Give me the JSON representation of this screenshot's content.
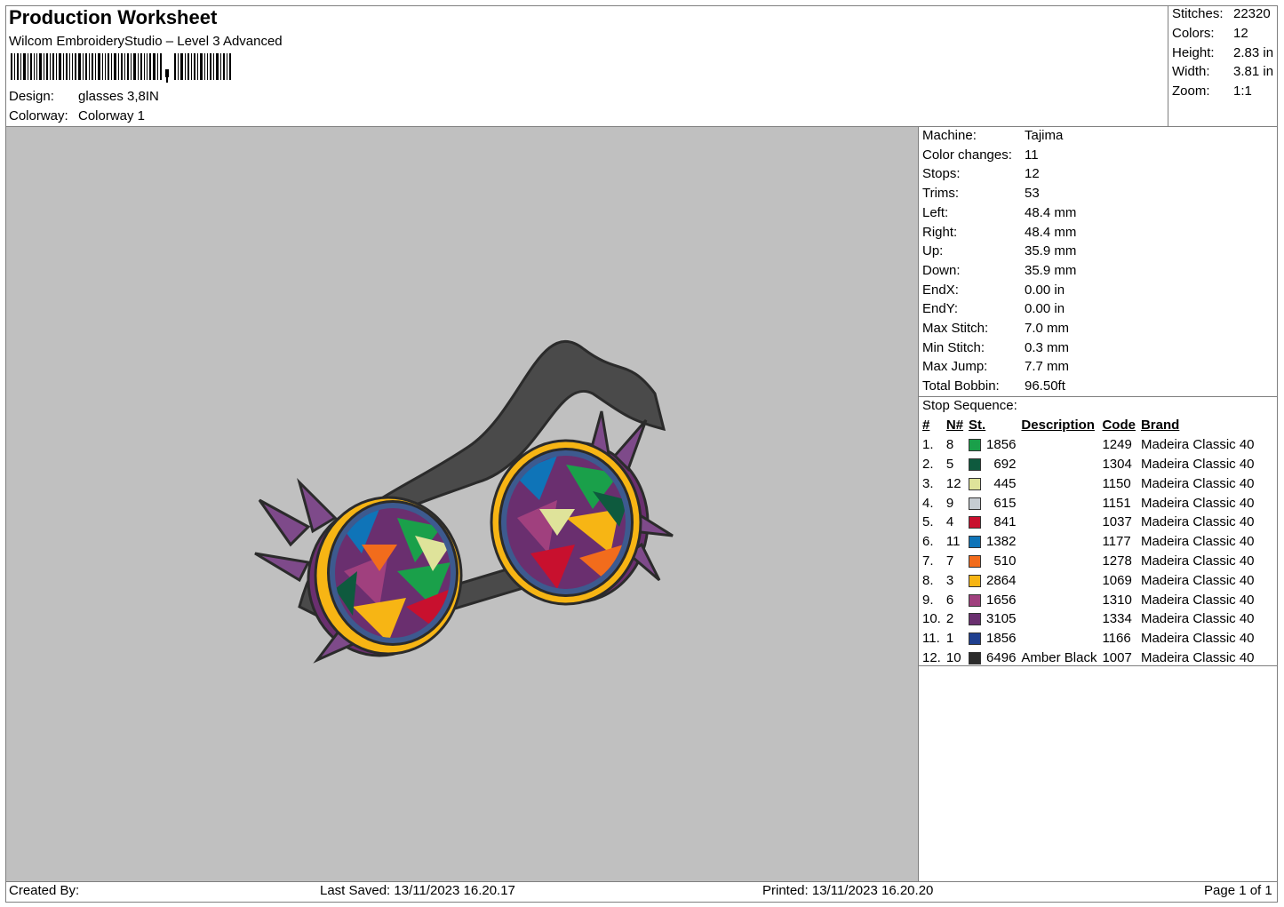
{
  "header": {
    "title": "Production Worksheet",
    "software": "Wilcom EmbroideryStudio – Level 3 Advanced",
    "design_label": "Design:",
    "design_value": "glasses 3,8IN",
    "colorway_label": "Colorway:",
    "colorway_value": "Colorway 1"
  },
  "summary": [
    {
      "label": "Stitches:",
      "value": "22320"
    },
    {
      "label": "Colors:",
      "value": "12"
    },
    {
      "label": "Height:",
      "value": "2.83 in"
    },
    {
      "label": "Width:",
      "value": "3.81 in"
    },
    {
      "label": "Zoom:",
      "value": "1:1"
    }
  ],
  "machine_info": [
    {
      "label": "Machine:",
      "value": "Tajima"
    },
    {
      "label": "Color changes:",
      "value": "11"
    },
    {
      "label": "Stops:",
      "value": "12"
    },
    {
      "label": "Trims:",
      "value": "53"
    },
    {
      "label": "Left:",
      "value": "48.4 mm"
    },
    {
      "label": "Right:",
      "value": "48.4 mm"
    },
    {
      "label": "Up:",
      "value": "35.9 mm"
    },
    {
      "label": "Down:",
      "value": "35.9 mm"
    },
    {
      "label": "EndX:",
      "value": "0.00 in"
    },
    {
      "label": "EndY:",
      "value": "0.00 in"
    },
    {
      "label": "Max Stitch:",
      "value": "7.0 mm"
    },
    {
      "label": "Min Stitch:",
      "value": "0.3 mm"
    },
    {
      "label": "Max Jump:",
      "value": "7.7 mm"
    },
    {
      "label": "Total Bobbin:",
      "value": "96.50ft"
    }
  ],
  "stop_sequence": {
    "title": "Stop Sequence:",
    "columns": [
      "#",
      "N#",
      "St.",
      "Description",
      "Code",
      "Brand"
    ],
    "rows": [
      {
        "num": "1.",
        "n": "8",
        "color": "#1aa04a",
        "st": "1856",
        "desc": "",
        "code": "1249",
        "brand": "Madeira Classic 40"
      },
      {
        "num": "2.",
        "n": "5",
        "color": "#0e5a3e",
        "st": "692",
        "desc": "",
        "code": "1304",
        "brand": "Madeira Classic 40"
      },
      {
        "num": "3.",
        "n": "12",
        "color": "#dfe39a",
        "st": "445",
        "desc": "",
        "code": "1150",
        "brand": "Madeira Classic 40"
      },
      {
        "num": "4.",
        "n": "9",
        "color": "#c6ccd2",
        "st": "615",
        "desc": "",
        "code": "1151",
        "brand": "Madeira Classic 40"
      },
      {
        "num": "5.",
        "n": "4",
        "color": "#c8102e",
        "st": "841",
        "desc": "",
        "code": "1037",
        "brand": "Madeira Classic 40"
      },
      {
        "num": "6.",
        "n": "11",
        "color": "#0f74b8",
        "st": "1382",
        "desc": "",
        "code": "1177",
        "brand": "Madeira Classic 40"
      },
      {
        "num": "7.",
        "n": "7",
        "color": "#f26c1c",
        "st": "510",
        "desc": "",
        "code": "1278",
        "brand": "Madeira Classic 40"
      },
      {
        "num": "8.",
        "n": "3",
        "color": "#f7b514",
        "st": "2864",
        "desc": "",
        "code": "1069",
        "brand": "Madeira Classic 40"
      },
      {
        "num": "9.",
        "n": "6",
        "color": "#a0407e",
        "st": "1656",
        "desc": "",
        "code": "1310",
        "brand": "Madeira Classic 40"
      },
      {
        "num": "10.",
        "n": "2",
        "color": "#6a2f6f",
        "st": "3105",
        "desc": "",
        "code": "1334",
        "brand": "Madeira Classic 40"
      },
      {
        "num": "11.",
        "n": "1",
        "color": "#1f3f8f",
        "st": "1856",
        "desc": "",
        "code": "1166",
        "brand": "Madeira Classic 40"
      },
      {
        "num": "12.",
        "n": "10",
        "color": "#2b2b2b",
        "st": "6496",
        "desc": "Amber Black",
        "code": "1007",
        "brand": "Madeira Classic 40"
      }
    ]
  },
  "footer": {
    "created_by": "Created By:",
    "last_saved": "Last Saved: 13/11/2023 16.20.17",
    "printed": "Printed: 13/11/2023 16.20.20",
    "page": "Page 1 of 1"
  }
}
